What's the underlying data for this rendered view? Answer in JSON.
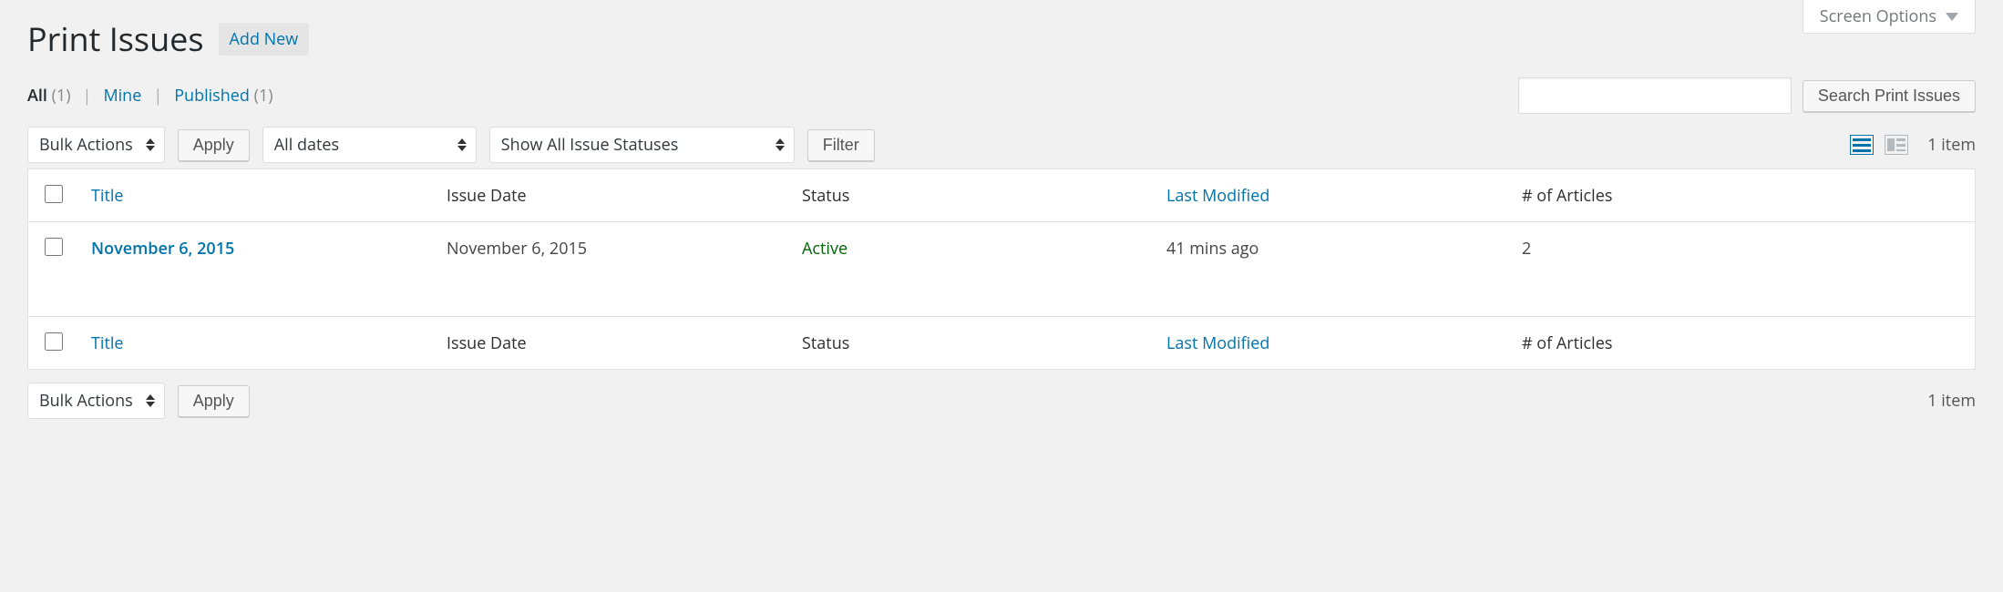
{
  "screen_options": {
    "label": "Screen Options"
  },
  "page": {
    "title": "Print Issues",
    "add_new_label": "Add New"
  },
  "filters": {
    "all_label": "All",
    "all_count": "(1)",
    "mine_label": "Mine",
    "published_label": "Published",
    "published_count": "(1)"
  },
  "search": {
    "button_label": "Search Print Issues"
  },
  "bulk": {
    "label": "Bulk Actions",
    "apply_label": "Apply"
  },
  "date_filter": {
    "label": "All dates"
  },
  "status_filter": {
    "label": "Show All Issue Statuses"
  },
  "filter_button": "Filter",
  "pagination": {
    "item_count": "1 item"
  },
  "columns": {
    "title": "Title",
    "issue_date": "Issue Date",
    "status": "Status",
    "last_modified": "Last Modified",
    "articles": "# of Articles"
  },
  "rows": [
    {
      "title": "November 6, 2015",
      "issue_date": "November 6, 2015",
      "status": "Active",
      "last_modified": "41 mins ago",
      "articles": "2"
    }
  ]
}
